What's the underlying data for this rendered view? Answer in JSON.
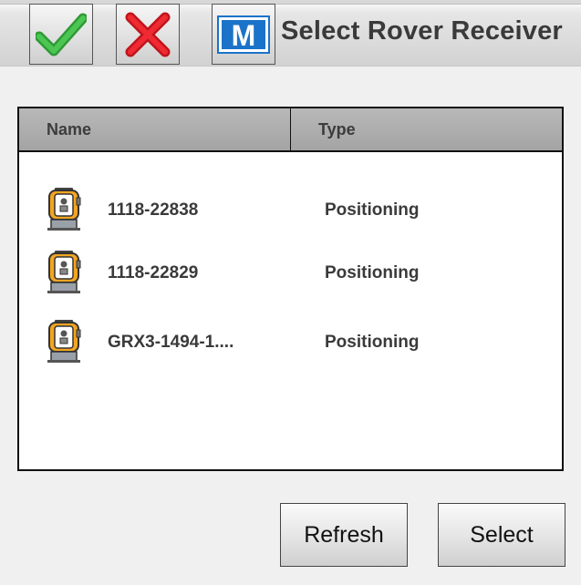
{
  "header": {
    "title": "Select Rover Receiver",
    "accept_icon": "green-checkmark-icon",
    "cancel_icon": "red-x-icon",
    "menu_icon": "m-logo-icon",
    "menu_letter": "M"
  },
  "table": {
    "columns": [
      "Name",
      "Type"
    ],
    "rows": [
      {
        "name": "1118-22838",
        "type": "Positioning",
        "icon": "total-station-icon"
      },
      {
        "name": "1118-22829",
        "type": "Positioning",
        "icon": "total-station-icon"
      },
      {
        "name": "GRX3-1494-1....",
        "type": "Positioning",
        "icon": "total-station-icon"
      }
    ]
  },
  "buttons": {
    "refresh": "Refresh",
    "select": "Select"
  },
  "colors": {
    "accept": "#3cb043",
    "cancel": "#e8222b",
    "menu_blue": "#1a73c9",
    "instrument_orange": "#f3a522"
  }
}
